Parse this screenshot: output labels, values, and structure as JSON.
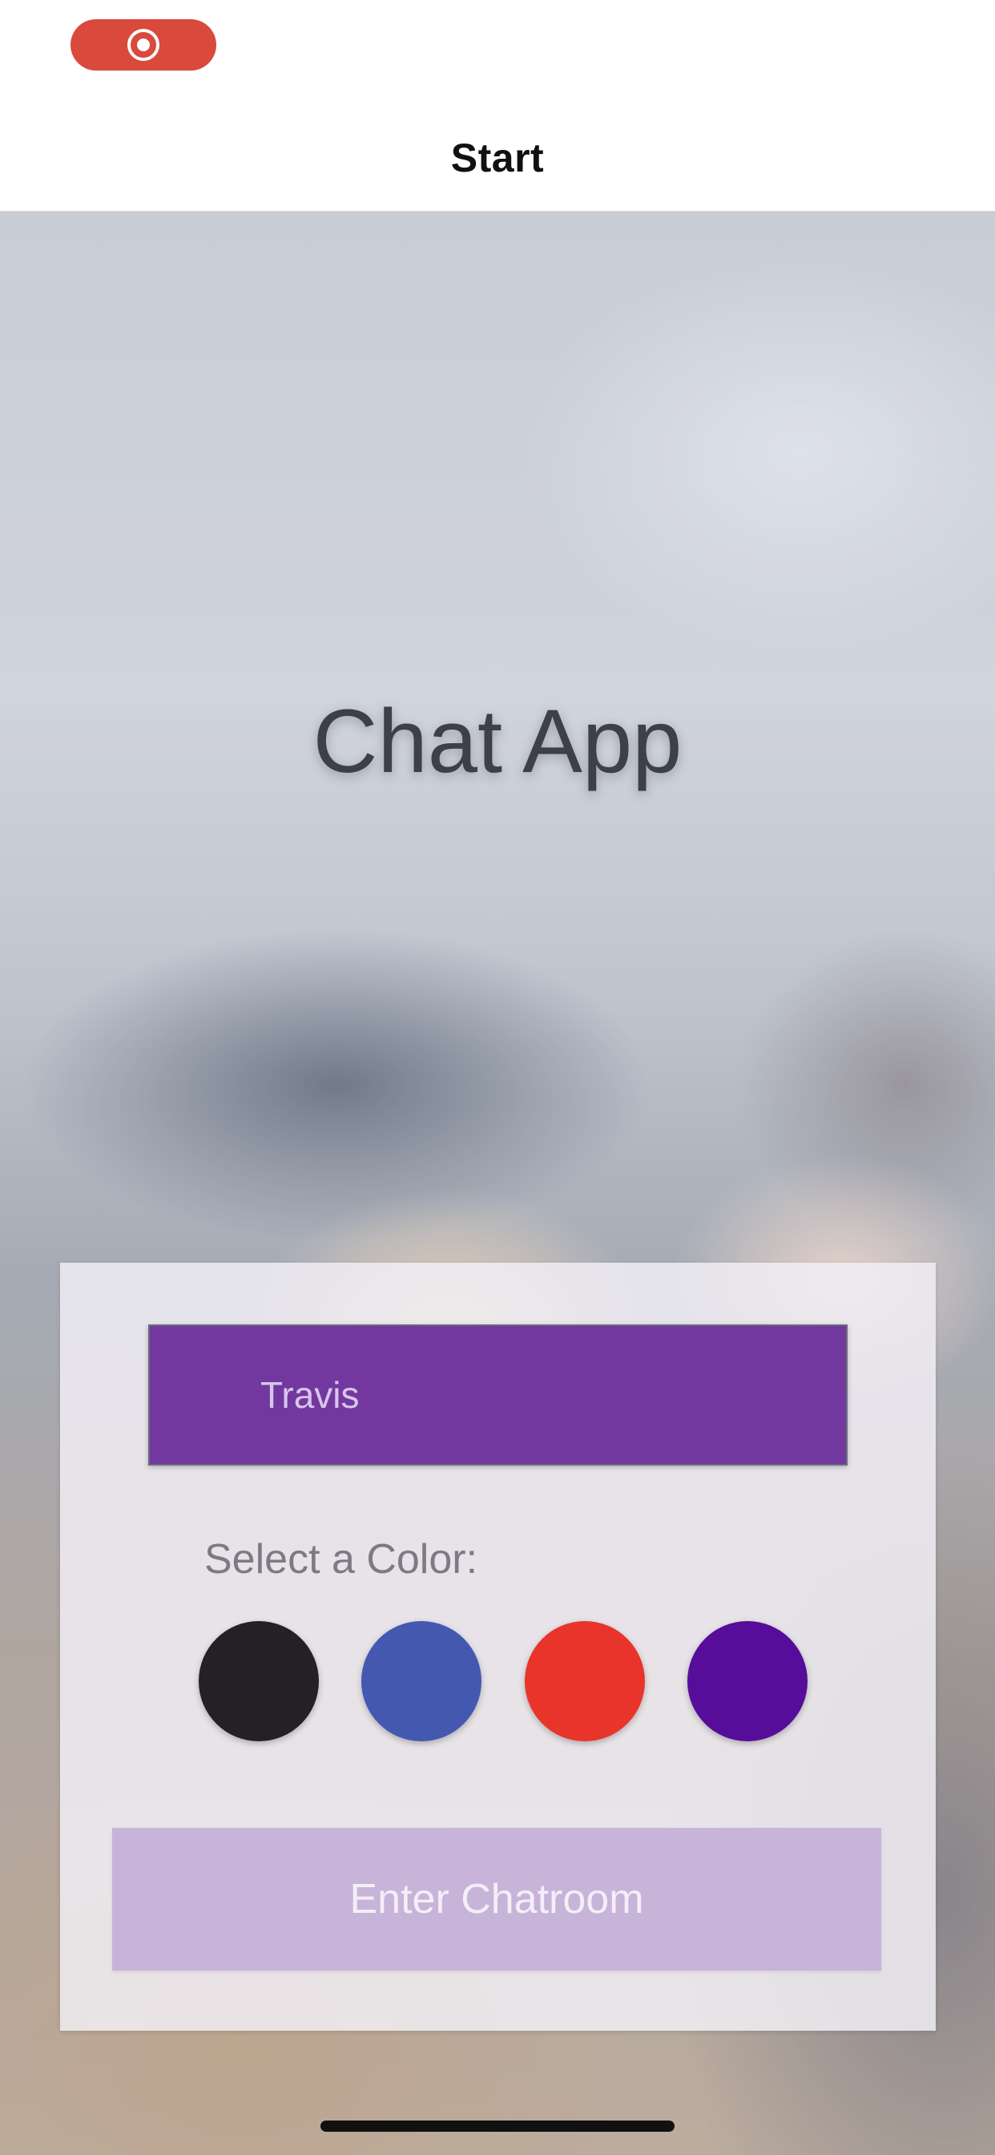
{
  "status": {
    "recording_icon": "record-icon",
    "recording_color": "#d9493c"
  },
  "nav": {
    "title": "Start"
  },
  "main": {
    "title": "Chat App"
  },
  "form": {
    "name_value": "Travis",
    "color_label": "Select a Color:",
    "colors": [
      {
        "name": "black",
        "hex": "#232124"
      },
      {
        "name": "blue",
        "hex": "#4458b0"
      },
      {
        "name": "red",
        "hex": "#e8342a"
      },
      {
        "name": "purple",
        "hex": "#560d99"
      }
    ],
    "enter_button": "Enter Chatroom",
    "input_color": "#7238a0",
    "button_color": "#c8b4d8"
  }
}
